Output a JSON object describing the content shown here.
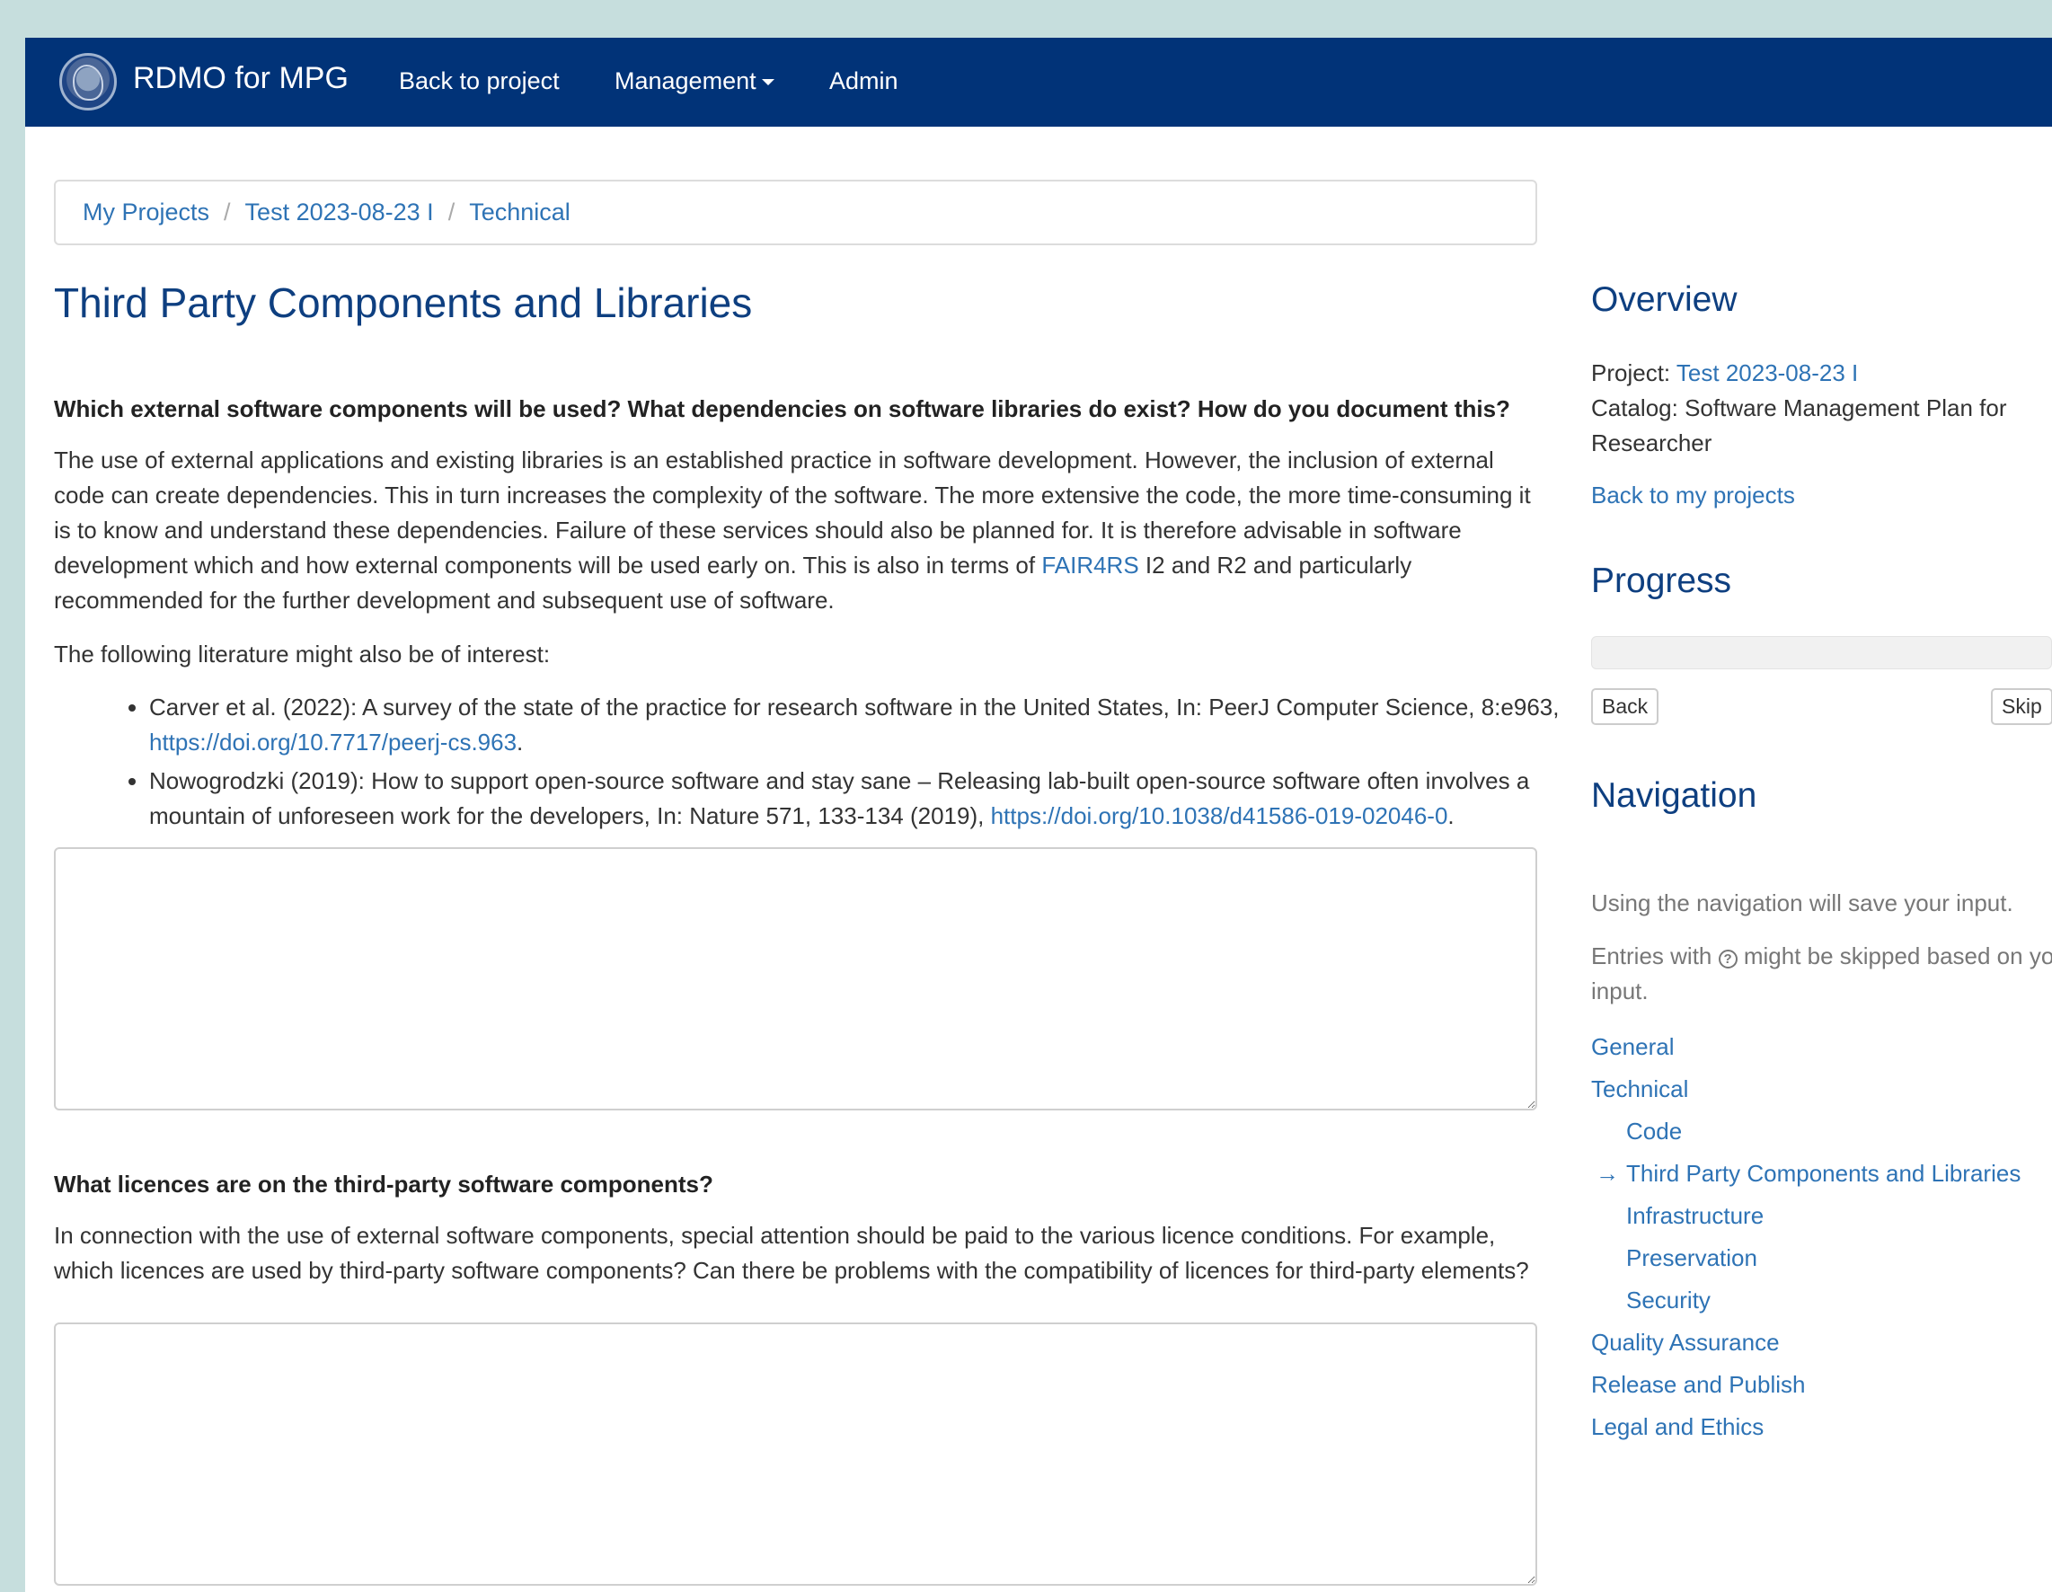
{
  "navbar": {
    "brand": "RDMO for MPG",
    "back_to_project": "Back to project",
    "management": "Management",
    "admin": "Admin"
  },
  "breadcrumb": {
    "items": [
      "My Projects",
      "Test 2023-08-23 I",
      "Technical"
    ],
    "separator": "/"
  },
  "page": {
    "title": "Third Party Components and Libraries"
  },
  "question1": {
    "label": "Which external software components will be used? What dependencies on software libraries do exist? How do you document this?",
    "help_before_link": "The use of external applications and existing libraries is an established practice in software development. However, the inclusion of external code can create dependencies. This in turn increases the complexity of the software. The more extensive the code, the more time-consuming it is to know and understand these dependencies. Failure of these services should also be planned for. It is therefore advisable in software development which and how external components will be used early on. This is also in terms of ",
    "help_link": "FAIR4RS",
    "help_after_link": " I2 and R2 and particularly recommended for the further development and subsequent use of software.",
    "literature_intro": "The following literature might also be of interest:",
    "literature": [
      {
        "text": "Carver et al. (2022): A survey of the state of the practice for research software in the United States, In: PeerJ Computer Science, 8:e963, ",
        "link": "https://doi.org/10.7717/peerj-cs.963",
        "after": "."
      },
      {
        "text": "Nowogrodzki (2019): How to support open-source software and stay sane – Releasing lab-built open-source software often involves a mountain of unforeseen work for the developers, In: Nature 571, 133-134 (2019), ",
        "link": "https://doi.org/10.1038/d41586-019-02046-0",
        "after": "."
      }
    ],
    "value": ""
  },
  "question2": {
    "label": "What licences are on the third-party software components?",
    "help": "In connection with the use of external software components, special attention should be paid to the various licence conditions. For example, which licences are used by third-party software components? Can there be problems with the compatibility of licences for third-party elements?",
    "value": ""
  },
  "overview": {
    "heading": "Overview",
    "project_label": "Project: ",
    "project_link": "Test 2023-08-23 I",
    "catalog": "Catalog: Software Management Plan for Researcher",
    "back_link": "Back to my projects"
  },
  "progress": {
    "heading": "Progress",
    "fraction": 0,
    "back_button": "Back",
    "skip_button": "Skip"
  },
  "navigation": {
    "heading": "Navigation",
    "info1": "Using the navigation will save your input.",
    "info2_before": "Entries with ",
    "info2_icon": "?",
    "info2_after": " might be skipped based on your input.",
    "current_marker": "→",
    "items": {
      "general": "General",
      "technical": "Technical",
      "code": "Code",
      "third_party": "Third Party Components and Libraries",
      "infrastructure": "Infrastructure",
      "preservation": "Preservation",
      "security": "Security",
      "quality": "Quality Assurance",
      "release": "Release and Publish",
      "legal": "Legal and Ethics"
    }
  },
  "colors": {
    "navbar": "#013378",
    "link": "#2e73b5",
    "heading": "#0e3f80",
    "background": "#c6dedd"
  }
}
